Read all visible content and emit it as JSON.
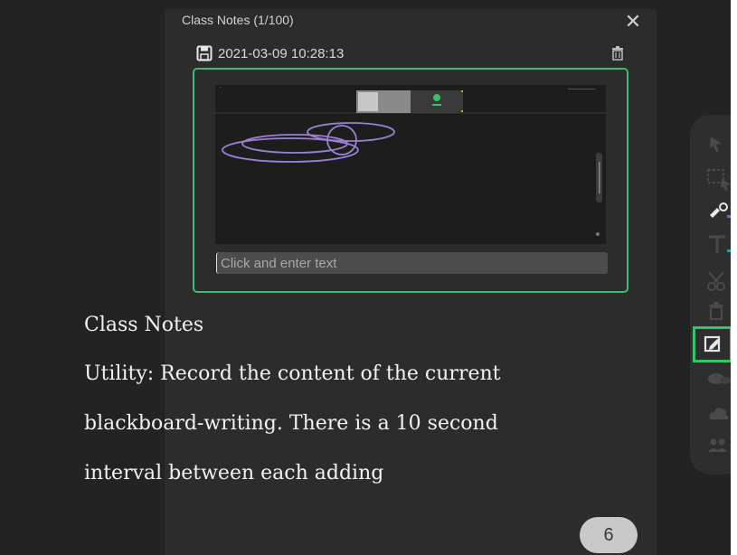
{
  "panel": {
    "title": "Class Notes (1/100)",
    "close_label": "✕",
    "note": {
      "timestamp": "2021-03-09 10:28:13",
      "input_placeholder": "Click and enter text"
    }
  },
  "tooltip": {
    "line1": "Class Notes",
    "line2": "Utility: Record the content of the current",
    "line3": "blackboard-writing. There is a 10 second",
    "line4": "interval between each adding"
  },
  "badge": {
    "value": "6"
  },
  "toolbar": {
    "tools": [
      "select-icon",
      "area-select-icon",
      "pen-icon",
      "text-icon",
      "scissors-icon",
      "trash-icon",
      "class-notes-icon",
      "chat-icon",
      "cloud-icon",
      "users-icon"
    ],
    "active": "class-notes-icon"
  },
  "colors": {
    "accent": "#3bbd6b",
    "background": "#232323",
    "panel": "#2c2c2c",
    "ink": "#9b7fd4"
  }
}
